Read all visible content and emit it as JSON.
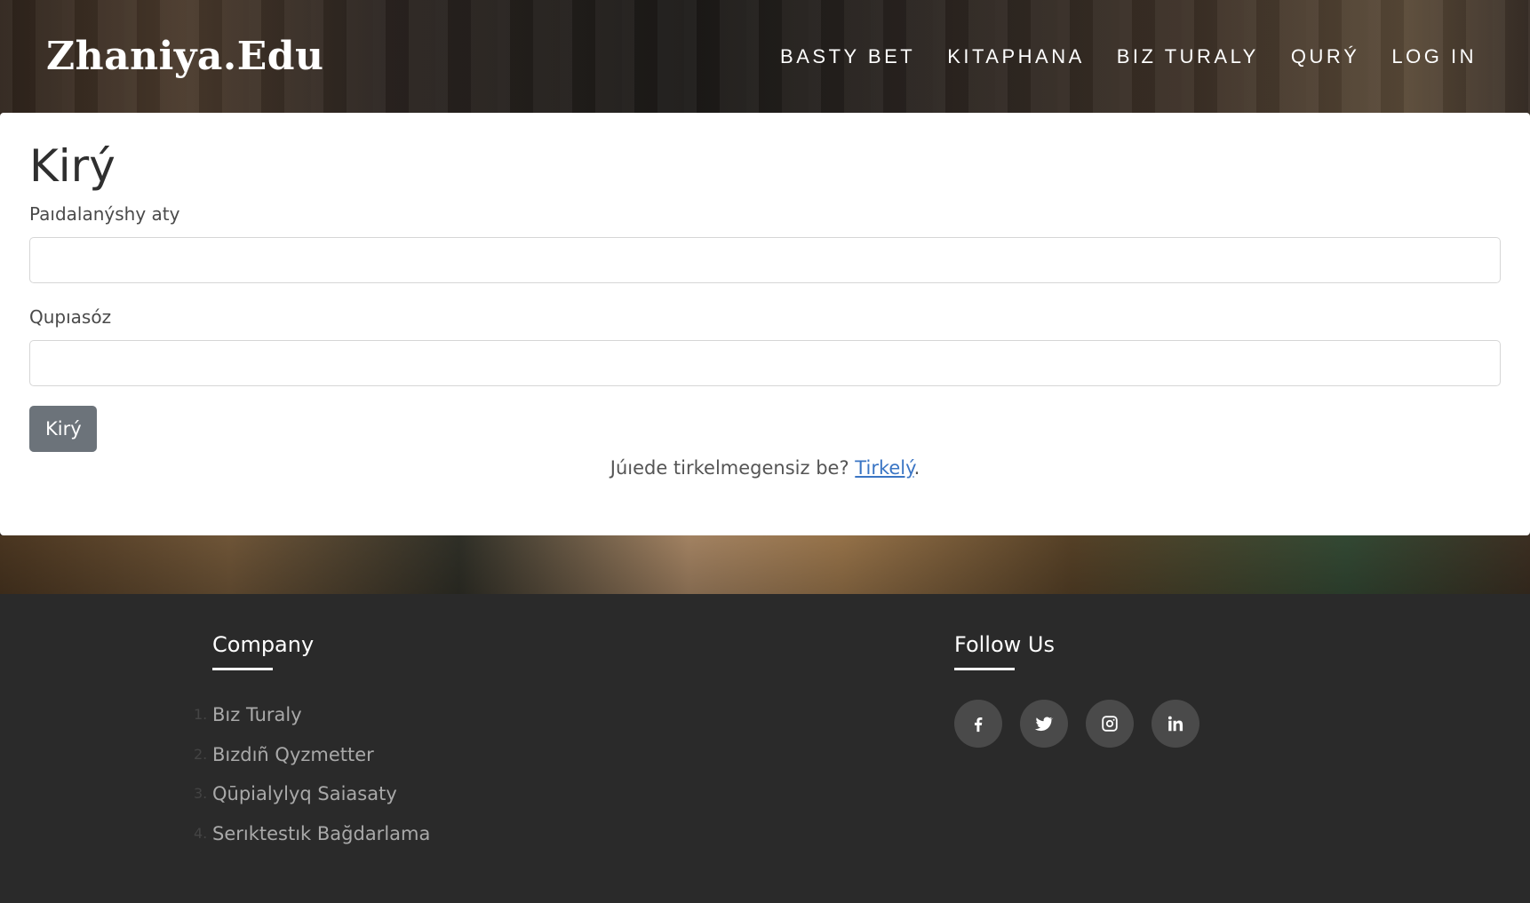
{
  "header": {
    "brand": "Zhaniya.Edu",
    "nav": [
      "BASTY BET",
      "KITAPHANA",
      "BIZ TURALY",
      "QURÝ",
      "LOG IN"
    ]
  },
  "login": {
    "title": "Kirý",
    "username_label": "Paıdalanýshy aty",
    "username_value": "",
    "password_label": "Qupıasóz",
    "password_value": "",
    "submit_label": "Kirý",
    "register_prompt": "Júıede tirkelmegensiz be?",
    "register_link": "Tirkelý",
    "register_suffix": "."
  },
  "footer": {
    "company_title": "Company",
    "company_links": [
      {
        "num": "1.",
        "label": "Bız Turaly"
      },
      {
        "num": "2.",
        "label": "Bızdıñ Qyzmetter"
      },
      {
        "num": "3.",
        "label": "Qūpialylyq Saiasaty"
      },
      {
        "num": "4.",
        "label": "Serıktestık Bağdarlama"
      }
    ],
    "follow_title": "Follow Us",
    "socials": [
      "facebook-icon",
      "twitter-icon",
      "instagram-icon",
      "linkedin-icon"
    ]
  }
}
